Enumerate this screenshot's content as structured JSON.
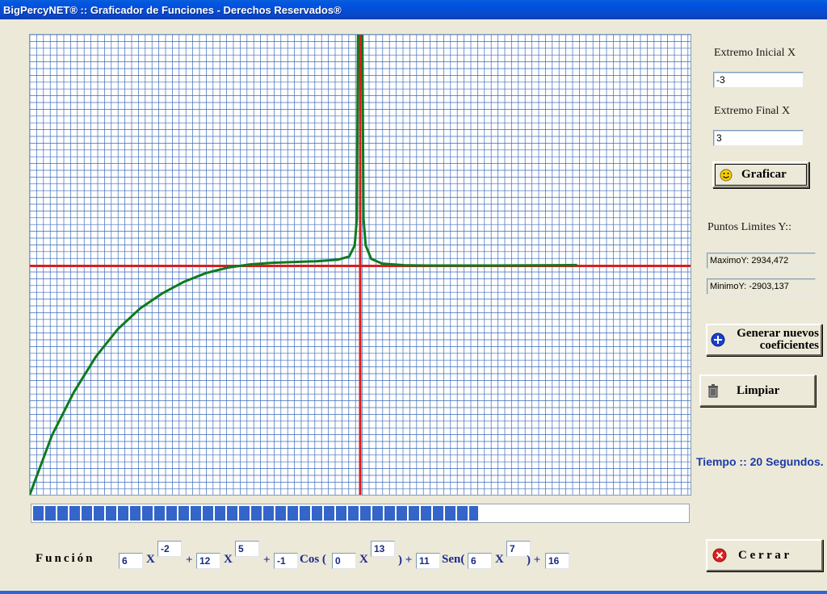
{
  "window": {
    "title": "BigPercyNET® :: Graficador de Funciones - Derechos Reservados®"
  },
  "panel": {
    "x_start_label": "Extremo Inicial X",
    "x_start_value": "-3",
    "x_end_label": "Extremo Final X",
    "x_end_value": "3",
    "plot_button": "Graficar",
    "y_limits_label": "Puntos Limites Y::",
    "max_y": "MaximoY: 2934,472",
    "min_y": "MinimoY: -2903,137",
    "new_coef_button_line1": "Generar nuevos",
    "new_coef_button_line2": "coeficientes",
    "clear_button": "Limpiar",
    "time_text": "Tiempo :: 20 Segundos.",
    "close_button": "C e r r a r"
  },
  "progress": {
    "percent": 68
  },
  "function": {
    "label": "Función",
    "c1": "6",
    "x1": "X",
    "e1": "-2",
    "plus1": "+",
    "c2": "12",
    "x2": "X",
    "e2": "5",
    "plus2": "+",
    "c3": "-1",
    "cos": "Cos (",
    "c4": "0",
    "x3": "X",
    "e3": "13",
    "close1": ") +",
    "c5": "11",
    "sen": "Sen(",
    "c6": "6",
    "x4": "X",
    "e4": "7",
    "close2": ") +",
    "c7": "16"
  },
  "colors": {
    "grid": "#3a6ab8",
    "axis": "#d42020",
    "curve": "#0e7a1e",
    "accent": "#1c3ba8"
  },
  "chart_data": {
    "type": "line",
    "x_range": [
      -3,
      3
    ],
    "y_range": [
      -2903.137,
      2934.472
    ],
    "grid": true,
    "series": [
      {
        "x": [
          -3,
          -2.8,
          -2.6,
          -2.4,
          -2.2,
          -2.0,
          -1.8,
          -1.6,
          -1.4,
          -1.2,
          -1.0,
          -0.8,
          -0.6,
          -0.4,
          -0.2,
          -0.1,
          -0.05,
          -0.03,
          -0.02,
          0.02,
          0.03,
          0.05,
          0.1,
          0.2,
          0.4,
          0.6,
          0.8,
          1.0,
          1.2,
          1.4,
          1.6,
          1.8,
          1.97
        ],
        "y": [
          -2900,
          -2150,
          -1600,
          -1150,
          -800,
          -540,
          -350,
          -200,
          -90,
          -20,
          20,
          40,
          50,
          60,
          80,
          120,
          260,
          600,
          2934,
          2934,
          600,
          260,
          90,
          30,
          10,
          5,
          5,
          5,
          5,
          6,
          7,
          10,
          12
        ]
      }
    ]
  }
}
